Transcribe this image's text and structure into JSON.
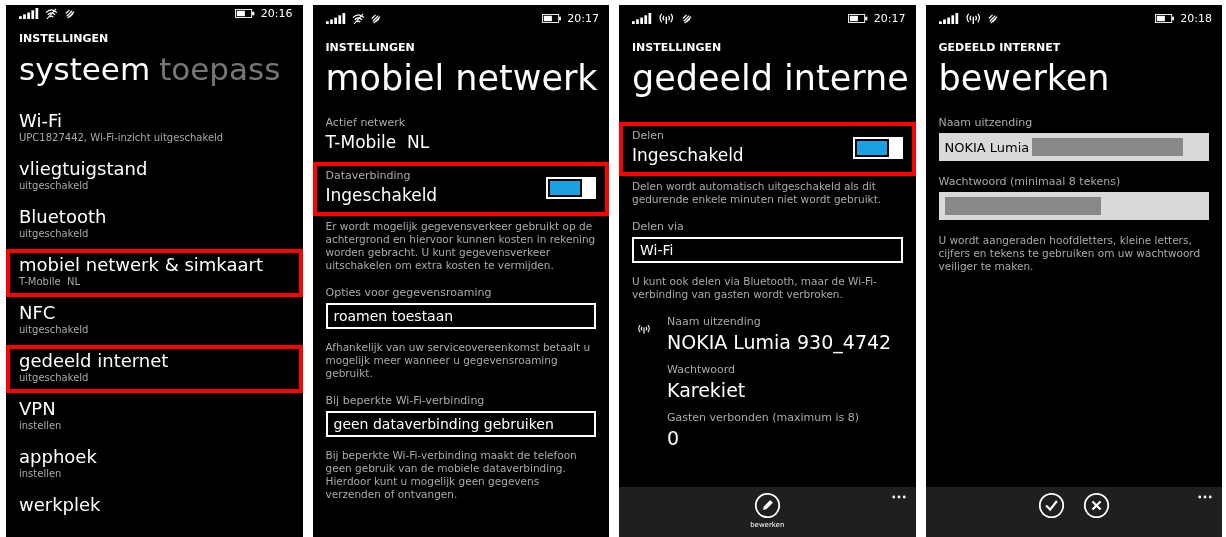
{
  "screens": [
    {
      "status": {
        "hotspot_active": false,
        "time": "20:16"
      },
      "header": "INSTELLINGEN",
      "pivot": [
        {
          "label": "systeem",
          "selected": true
        },
        {
          "label": "toepass",
          "selected": false
        }
      ],
      "items": [
        {
          "title": "Wi-Fi",
          "subtitle": "UPC1827442, Wi-Fi-inzicht uitgeschakeld",
          "highlighted": false
        },
        {
          "title": "vliegtuigstand",
          "subtitle": "uitgeschakeld",
          "highlighted": false
        },
        {
          "title": "Bluetooth",
          "subtitle": "uitgeschakeld",
          "highlighted": false
        },
        {
          "title": "mobiel netwerk & simkaart",
          "subtitle": "T-Mobile  NL",
          "highlighted": true
        },
        {
          "title": "NFC",
          "subtitle": "uitgeschakeld",
          "highlighted": false
        },
        {
          "title": "gedeeld internet",
          "subtitle": "uitgeschakeld",
          "highlighted": true
        },
        {
          "title": "VPN",
          "subtitle": "instellen",
          "highlighted": false
        },
        {
          "title": "apphoek",
          "subtitle": "instellen",
          "highlighted": false
        },
        {
          "title": "werkplek",
          "highlighted": false
        }
      ]
    },
    {
      "status": {
        "hotspot_active": false,
        "time": "20:17"
      },
      "header": "INSTELLINGEN",
      "title": "mobiel netwerk",
      "sections": [
        {
          "kind": "value",
          "label": "Actief netwerk",
          "value": "T-Mobile  NL"
        },
        {
          "kind": "toggle",
          "label": "Dataverbinding",
          "value": "Ingeschakeld",
          "on": true,
          "highlighted": true
        },
        {
          "kind": "note",
          "text": "Er wordt mogelijk gegevensverkeer gebruikt op de achtergrond en hiervoor kunnen kosten in rekening worden gebracht. U kunt gegevensverkeer uitschakelen om extra kosten te vermijden."
        },
        {
          "kind": "select",
          "label": "Opties voor gegevensroaming",
          "value": "roamen toestaan"
        },
        {
          "kind": "note",
          "text": "Afhankelijk van uw serviceovereenkomst betaalt u mogelijk meer wanneer u gegevensroaming gebruikt."
        },
        {
          "kind": "select",
          "label": "Bij beperkte Wi-Fi-verbinding",
          "value": "geen dataverbinding gebruiken"
        },
        {
          "kind": "note",
          "text": "Bij beperkte Wi-Fi-verbinding maakt de telefoon geen gebruik van de mobiele dataverbinding. Hierdoor kunt u mogelijk geen gegevens verzenden of ontvangen."
        }
      ]
    },
    {
      "status": {
        "hotspot_active": true,
        "time": "20:17"
      },
      "header": "INSTELLINGEN",
      "title": "gedeeld interne",
      "sections": [
        {
          "kind": "toggle",
          "label": "Delen",
          "value": "Ingeschakeld",
          "on": true,
          "highlighted": true
        },
        {
          "kind": "note",
          "text": "Delen wordt automatisch uitgeschakeld als dit gedurende enkele minuten niet wordt gebruikt."
        },
        {
          "kind": "select",
          "label": "Delen via",
          "value": "Wi-Fi"
        },
        {
          "kind": "note",
          "text": "U kunt ook delen via Bluetooth, maar de Wi-Fi-verbinding van gasten wordt verbroken."
        },
        {
          "kind": "broadcast",
          "label": "Naam uitzending",
          "value": "NOKIA Lumia 930_4742"
        },
        {
          "kind": "info",
          "label": "Wachtwoord",
          "value": "Karekiet"
        },
        {
          "kind": "info",
          "label": "Gasten verbonden (maximum is 8)",
          "value": "0"
        }
      ],
      "app_bar": [
        {
          "kind": "edit",
          "label": "bewerken"
        }
      ]
    },
    {
      "status": {
        "hotspot_active": true,
        "time": "20:18"
      },
      "header": "GEDEELD INTERNET",
      "title": "bewerken",
      "sections": [
        {
          "kind": "textbox",
          "label": "Naam uitzending",
          "value": "NOKIA Lumia",
          "redacted": true
        },
        {
          "kind": "textbox",
          "label": "Wachtwoord (minimaal 8 tekens)",
          "redacted": true
        },
        {
          "kind": "note",
          "text": "U wordt aangeraden hoofdletters, kleine letters, cijfers en tekens te gebruiken om uw wachtwoord veiliger te maken."
        }
      ],
      "app_bar": [
        {
          "kind": "accept"
        },
        {
          "kind": "cancel"
        }
      ]
    }
  ]
}
